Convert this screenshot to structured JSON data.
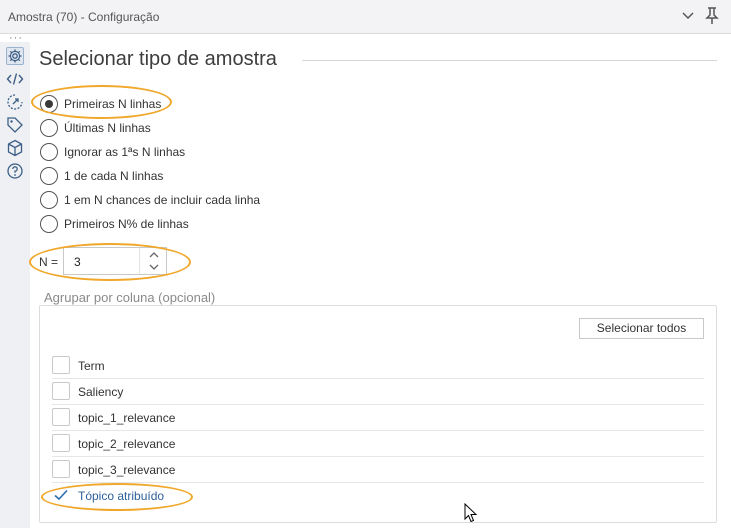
{
  "window": {
    "title": "Amostra (70) - Configuração"
  },
  "titlebar_icons": [
    "chevron-down-icon",
    "pin-icon"
  ],
  "sidebar": {
    "overflow": "···",
    "items": [
      {
        "icon": "gear-icon",
        "active": true
      },
      {
        "icon": "code-icon",
        "active": false
      },
      {
        "icon": "annotation-icon",
        "active": false
      },
      {
        "icon": "tag-icon",
        "active": false
      },
      {
        "icon": "cube-icon",
        "active": false
      },
      {
        "icon": "help-icon",
        "active": false
      }
    ]
  },
  "main": {
    "heading": "Selecionar tipo de amostra",
    "sample_options": [
      {
        "label": "Primeiras N linhas",
        "checked": true
      },
      {
        "label": "Últimas N linhas",
        "checked": false
      },
      {
        "label": "Ignorar as 1ªs N linhas",
        "checked": false
      },
      {
        "label": "1 de cada N linhas",
        "checked": false
      },
      {
        "label": "1 em N chances de incluir cada linha",
        "checked": false
      },
      {
        "label": "Primeiros N% de linhas",
        "checked": false
      }
    ],
    "n_field": {
      "label": "N =",
      "value": "3"
    },
    "group_by": {
      "label": "Agrupar por coluna (opcional)",
      "select_all_label": "Selecionar todos",
      "columns": [
        {
          "label": "Term",
          "checked": false
        },
        {
          "label": "Saliency",
          "checked": false
        },
        {
          "label": "topic_1_relevance",
          "checked": false
        },
        {
          "label": "topic_2_relevance",
          "checked": false
        },
        {
          "label": "topic_3_relevance",
          "checked": false
        },
        {
          "label": "Tópico atribuído",
          "checked": true
        }
      ]
    }
  },
  "colors": {
    "highlight": "#f0a72a",
    "selected_text": "#2d5f9a",
    "check": "#2b6cb0"
  }
}
